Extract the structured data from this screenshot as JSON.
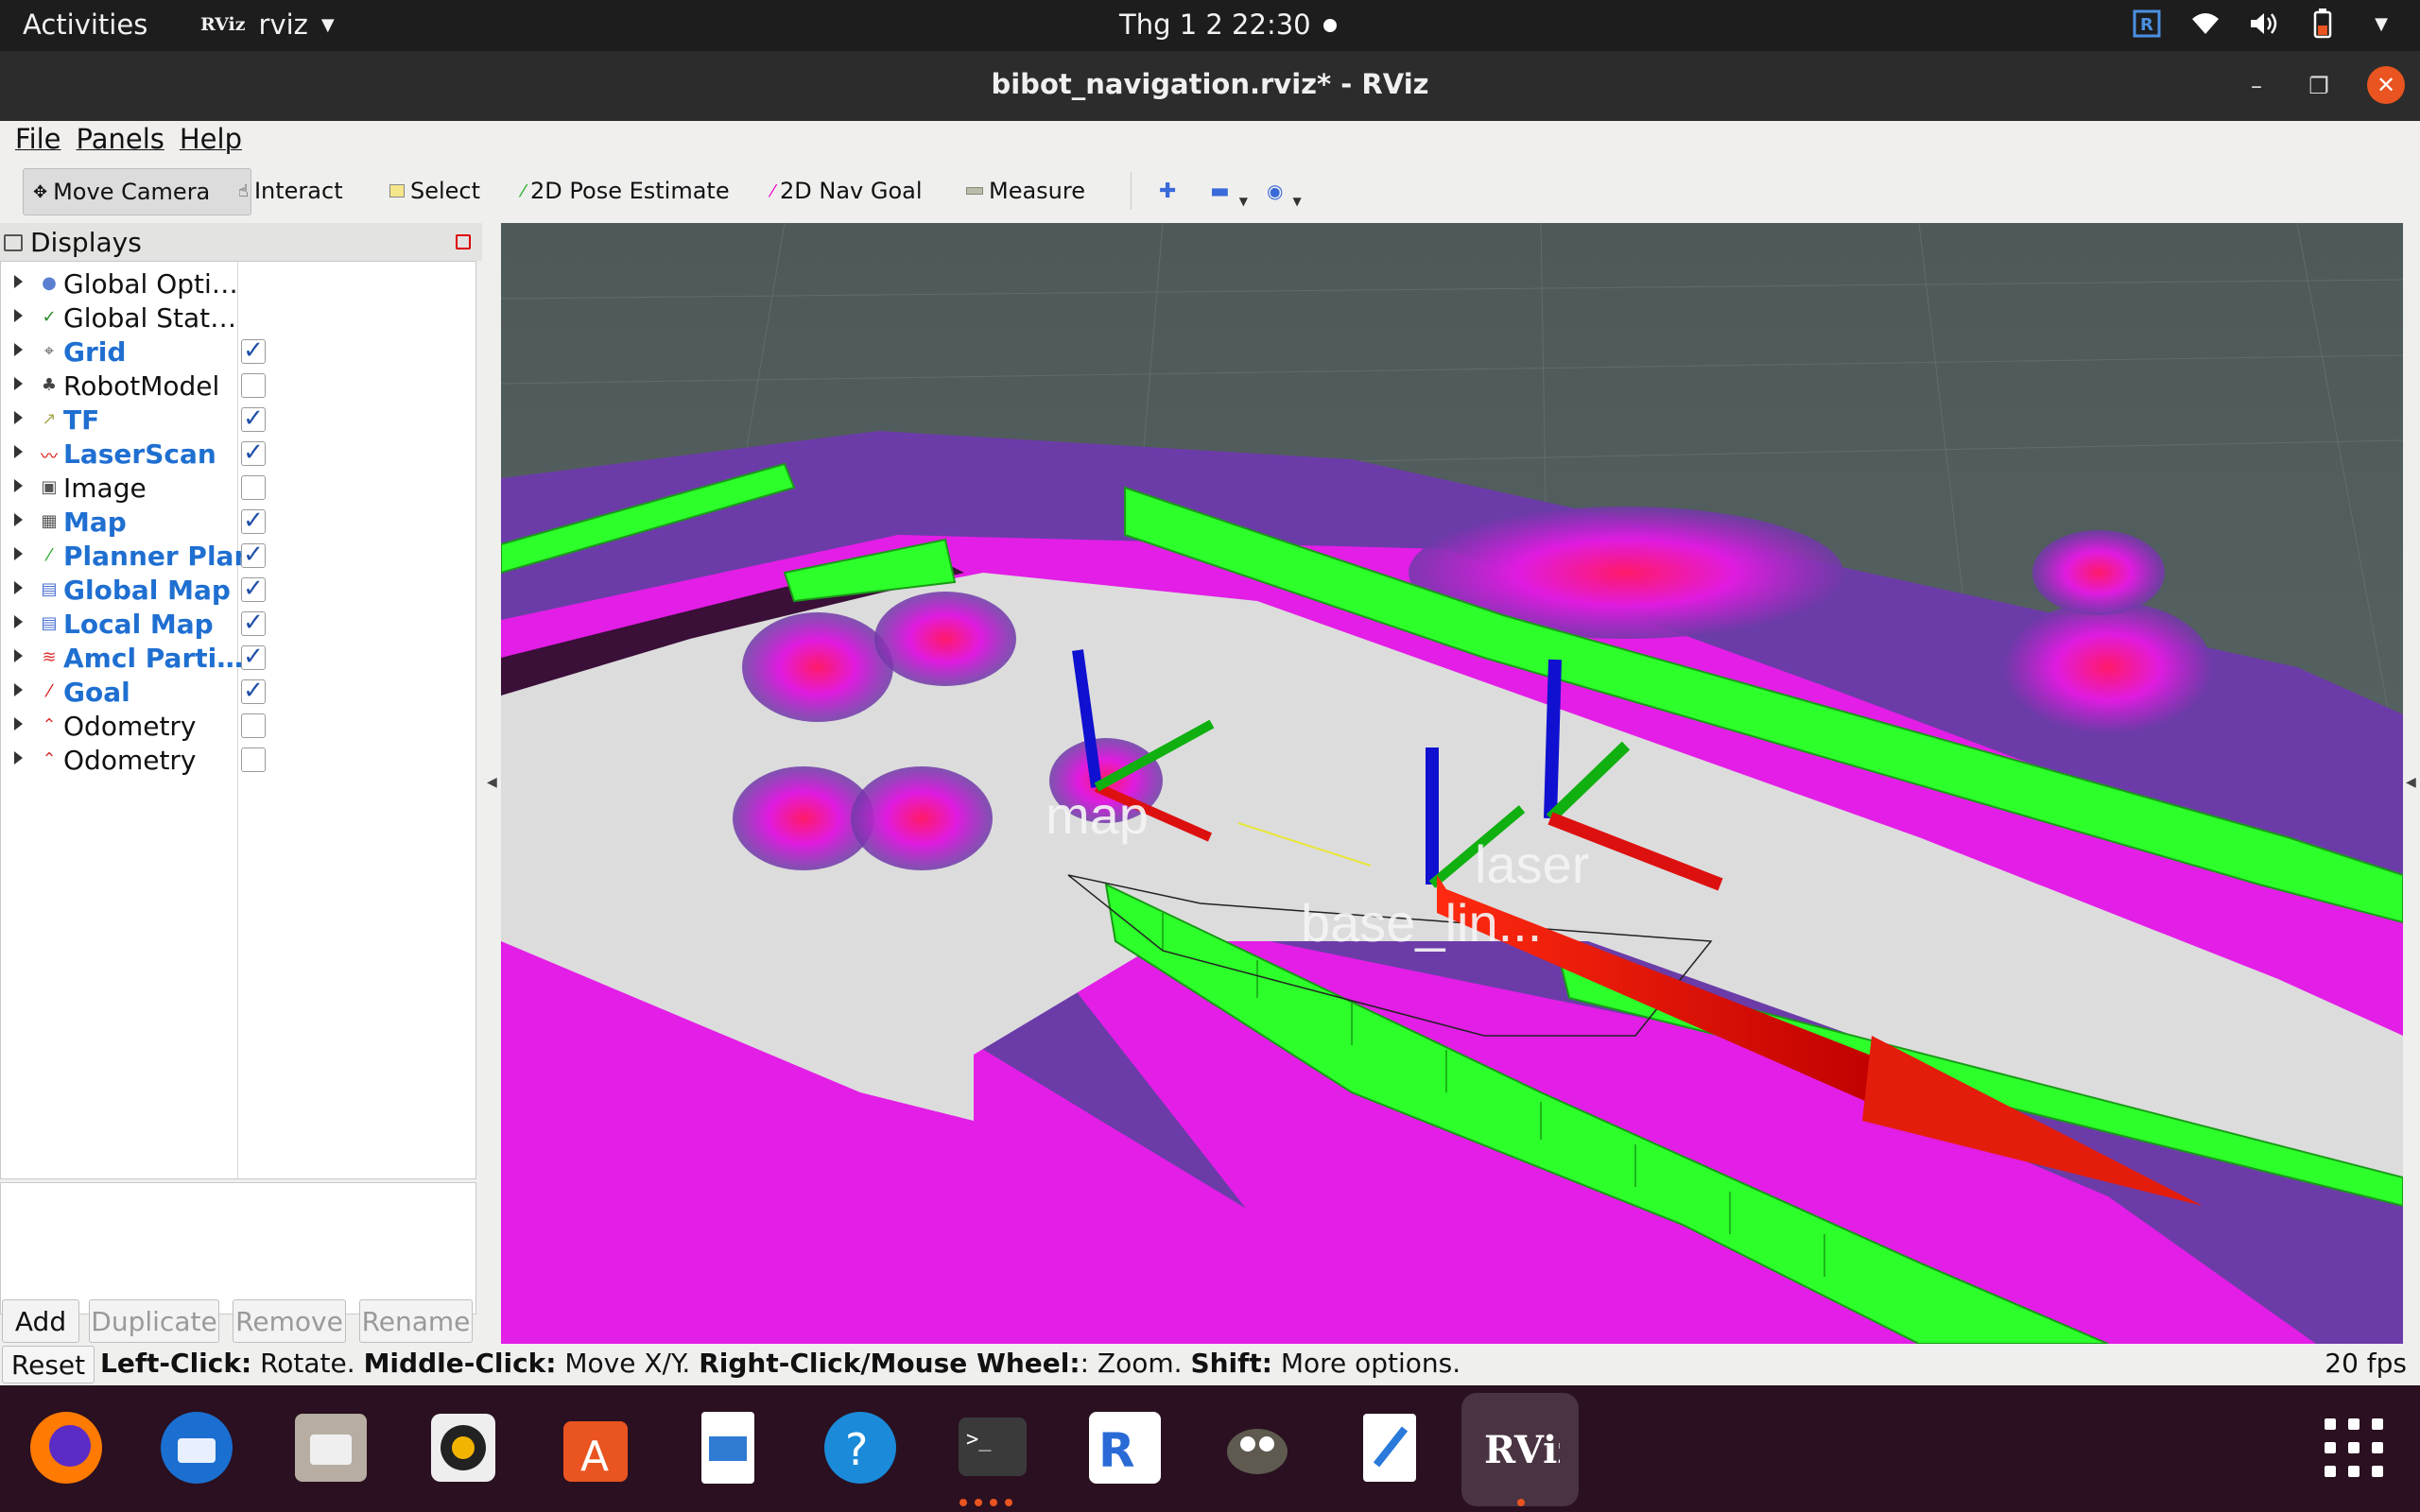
{
  "topbar": {
    "activities": "Activities",
    "app_logo": "RViz",
    "app_name": "rviz",
    "clock": "Thg 1 2  22:30"
  },
  "window": {
    "title": "bibot_navigation.rviz* - RViz"
  },
  "menu": {
    "file": "File",
    "panels": "Panels",
    "help": "Help"
  },
  "toolbar": {
    "move_camera": "Move Camera",
    "interact": "Interact",
    "select": "Select",
    "pose_estimate": "2D Pose Estimate",
    "nav_goal": "2D Nav Goal",
    "measure": "Measure"
  },
  "displays": {
    "header": "Displays",
    "items": [
      {
        "label": "Global Opti…",
        "enabled": null,
        "icon": "globe-icon"
      },
      {
        "label": "Global Stat…",
        "enabled": null,
        "icon": "check-icon"
      },
      {
        "label": "Grid",
        "enabled": true,
        "icon": "grid-icon"
      },
      {
        "label": "RobotModel",
        "enabled": false,
        "icon": "robot-icon"
      },
      {
        "label": "TF",
        "enabled": true,
        "icon": "tf-icon"
      },
      {
        "label": "LaserScan",
        "enabled": true,
        "icon": "laserscan-icon"
      },
      {
        "label": "Image",
        "enabled": false,
        "icon": "image-icon"
      },
      {
        "label": "Map",
        "enabled": true,
        "icon": "map-icon"
      },
      {
        "label": "Planner Plan",
        "enabled": true,
        "icon": "path-icon"
      },
      {
        "label": "Global Map",
        "enabled": true,
        "icon": "map-folder-icon"
      },
      {
        "label": "Local Map",
        "enabled": true,
        "icon": "map-folder-icon"
      },
      {
        "label": "Amcl Parti…",
        "enabled": true,
        "icon": "particles-icon"
      },
      {
        "label": "Goal",
        "enabled": true,
        "icon": "goal-icon"
      },
      {
        "label": "Odometry",
        "enabled": false,
        "icon": "odometry-icon"
      },
      {
        "label": "Odometry",
        "enabled": false,
        "icon": "odometry-icon"
      }
    ],
    "buttons": {
      "add": "Add",
      "duplicate": "Duplicate",
      "remove": "Remove",
      "rename": "Rename"
    }
  },
  "viewport": {
    "frame_labels": {
      "map": "map",
      "laser": "laser",
      "base": "base_lin..."
    }
  },
  "status": {
    "reset": "Reset",
    "left_click": "Left-Click:",
    "rotate": " Rotate. ",
    "middle_click": "Middle-Click:",
    "move": " Move X/Y. ",
    "right_click": "Right-Click/Mouse Wheel:",
    "zoom": ": Zoom. ",
    "shift": "Shift:",
    "more": " More options.",
    "fps": "20 fps"
  },
  "dock": {
    "apps": [
      "firefox-icon",
      "thunderbird-icon",
      "files-icon",
      "rhythmbox-icon",
      "software-icon",
      "writer-icon",
      "help-icon",
      "terminal-icon",
      "vnc-icon",
      "gimp-icon",
      "text-editor-icon",
      "rviz-icon"
    ]
  },
  "colors": {
    "costmap_magenta": "#e11be6",
    "obstacle_green": "#22ff22",
    "accent_orange": "#e95420"
  }
}
